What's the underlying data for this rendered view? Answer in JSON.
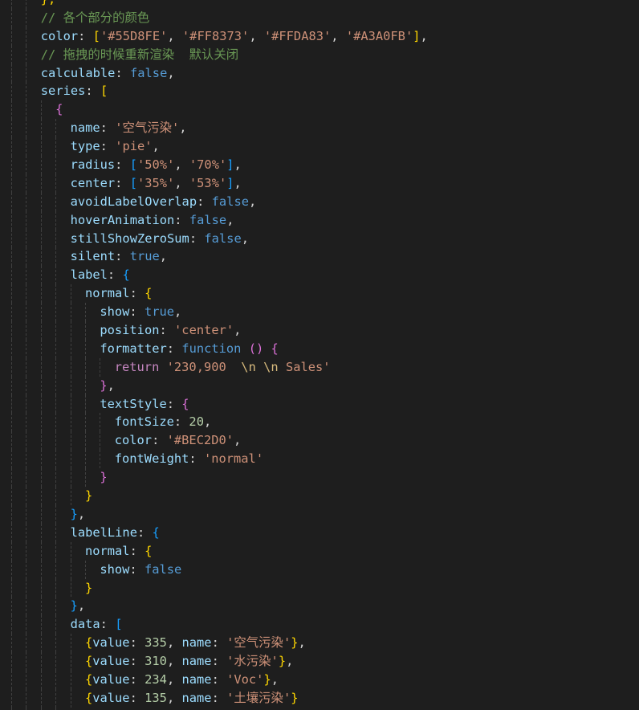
{
  "lines": [
    {
      "indent": 2,
      "tokens": [
        {
          "t": "},",
          "c": "b1"
        }
      ]
    },
    {
      "indent": 2,
      "tokens": [
        {
          "t": "// 各个部分的颜色",
          "c": "cmt"
        }
      ]
    },
    {
      "indent": 2,
      "tokens": [
        {
          "t": "color",
          "c": "key"
        },
        {
          "t": ": ",
          "c": "punc"
        },
        {
          "t": "[",
          "c": "b1"
        },
        {
          "t": "'#55D8FE'",
          "c": "str"
        },
        {
          "t": ", ",
          "c": "punc"
        },
        {
          "t": "'#FF8373'",
          "c": "str"
        },
        {
          "t": ", ",
          "c": "punc"
        },
        {
          "t": "'#FFDA83'",
          "c": "str"
        },
        {
          "t": ", ",
          "c": "punc"
        },
        {
          "t": "'#A3A0FB'",
          "c": "str"
        },
        {
          "t": "]",
          "c": "b1"
        },
        {
          "t": ",",
          "c": "punc"
        }
      ]
    },
    {
      "indent": 2,
      "tokens": [
        {
          "t": "// 拖拽的时候重新渲染  默认关闭",
          "c": "cmt"
        }
      ]
    },
    {
      "indent": 2,
      "tokens": [
        {
          "t": "calculable",
          "c": "key"
        },
        {
          "t": ": ",
          "c": "punc"
        },
        {
          "t": "false",
          "c": "bool"
        },
        {
          "t": ",",
          "c": "punc"
        }
      ]
    },
    {
      "indent": 2,
      "tokens": [
        {
          "t": "series",
          "c": "key"
        },
        {
          "t": ": ",
          "c": "punc"
        },
        {
          "t": "[",
          "c": "b1"
        }
      ]
    },
    {
      "indent": 3,
      "tokens": [
        {
          "t": "{",
          "c": "b2"
        }
      ]
    },
    {
      "indent": 4,
      "tokens": [
        {
          "t": "name",
          "c": "key"
        },
        {
          "t": ": ",
          "c": "punc"
        },
        {
          "t": "'空气污染'",
          "c": "str"
        },
        {
          "t": ",",
          "c": "punc"
        }
      ]
    },
    {
      "indent": 4,
      "tokens": [
        {
          "t": "type",
          "c": "key"
        },
        {
          "t": ": ",
          "c": "punc"
        },
        {
          "t": "'pie'",
          "c": "str"
        },
        {
          "t": ",",
          "c": "punc"
        }
      ]
    },
    {
      "indent": 4,
      "tokens": [
        {
          "t": "radius",
          "c": "key"
        },
        {
          "t": ": ",
          "c": "punc"
        },
        {
          "t": "[",
          "c": "b3"
        },
        {
          "t": "'50%'",
          "c": "str"
        },
        {
          "t": ", ",
          "c": "punc"
        },
        {
          "t": "'70%'",
          "c": "str"
        },
        {
          "t": "]",
          "c": "b3"
        },
        {
          "t": ",",
          "c": "punc"
        }
      ]
    },
    {
      "indent": 4,
      "tokens": [
        {
          "t": "center",
          "c": "key"
        },
        {
          "t": ": ",
          "c": "punc"
        },
        {
          "t": "[",
          "c": "b3"
        },
        {
          "t": "'35%'",
          "c": "str"
        },
        {
          "t": ", ",
          "c": "punc"
        },
        {
          "t": "'53%'",
          "c": "str"
        },
        {
          "t": "]",
          "c": "b3"
        },
        {
          "t": ",",
          "c": "punc"
        }
      ]
    },
    {
      "indent": 4,
      "tokens": [
        {
          "t": "avoidLabelOverlap",
          "c": "key"
        },
        {
          "t": ": ",
          "c": "punc"
        },
        {
          "t": "false",
          "c": "bool"
        },
        {
          "t": ",",
          "c": "punc"
        }
      ]
    },
    {
      "indent": 4,
      "tokens": [
        {
          "t": "hoverAnimation",
          "c": "key"
        },
        {
          "t": ": ",
          "c": "punc"
        },
        {
          "t": "false",
          "c": "bool"
        },
        {
          "t": ",",
          "c": "punc"
        }
      ]
    },
    {
      "indent": 4,
      "tokens": [
        {
          "t": "stillShowZeroSum",
          "c": "key"
        },
        {
          "t": ": ",
          "c": "punc"
        },
        {
          "t": "false",
          "c": "bool"
        },
        {
          "t": ",",
          "c": "punc"
        }
      ]
    },
    {
      "indent": 4,
      "tokens": [
        {
          "t": "silent",
          "c": "key"
        },
        {
          "t": ": ",
          "c": "punc"
        },
        {
          "t": "true",
          "c": "bool"
        },
        {
          "t": ",",
          "c": "punc"
        }
      ]
    },
    {
      "indent": 4,
      "tokens": [
        {
          "t": "label",
          "c": "key"
        },
        {
          "t": ": ",
          "c": "punc"
        },
        {
          "t": "{",
          "c": "b3"
        }
      ]
    },
    {
      "indent": 5,
      "tokens": [
        {
          "t": "normal",
          "c": "key"
        },
        {
          "t": ": ",
          "c": "punc"
        },
        {
          "t": "{",
          "c": "b1"
        }
      ]
    },
    {
      "indent": 6,
      "tokens": [
        {
          "t": "show",
          "c": "key"
        },
        {
          "t": ": ",
          "c": "punc"
        },
        {
          "t": "true",
          "c": "bool"
        },
        {
          "t": ",",
          "c": "punc"
        }
      ]
    },
    {
      "indent": 6,
      "tokens": [
        {
          "t": "position",
          "c": "key"
        },
        {
          "t": ": ",
          "c": "punc"
        },
        {
          "t": "'center'",
          "c": "str"
        },
        {
          "t": ",",
          "c": "punc"
        }
      ]
    },
    {
      "indent": 6,
      "tokens": [
        {
          "t": "formatter",
          "c": "key"
        },
        {
          "t": ": ",
          "c": "punc"
        },
        {
          "t": "function",
          "c": "kw"
        },
        {
          "t": " ",
          "c": "punc"
        },
        {
          "t": "()",
          "c": "b2"
        },
        {
          "t": " ",
          "c": "punc"
        },
        {
          "t": "{",
          "c": "b2"
        }
      ]
    },
    {
      "indent": 7,
      "tokens": [
        {
          "t": "return",
          "c": "ctl"
        },
        {
          "t": " ",
          "c": "punc"
        },
        {
          "t": "'230,900  ",
          "c": "str"
        },
        {
          "t": "\\n",
          "c": "esc"
        },
        {
          "t": " ",
          "c": "str"
        },
        {
          "t": "\\n",
          "c": "esc"
        },
        {
          "t": " Sales'",
          "c": "str"
        }
      ]
    },
    {
      "indent": 6,
      "tokens": [
        {
          "t": "}",
          "c": "b2"
        },
        {
          "t": ",",
          "c": "punc"
        }
      ]
    },
    {
      "indent": 6,
      "tokens": [
        {
          "t": "textStyle",
          "c": "key"
        },
        {
          "t": ": ",
          "c": "punc"
        },
        {
          "t": "{",
          "c": "b2"
        }
      ]
    },
    {
      "indent": 7,
      "tokens": [
        {
          "t": "fontSize",
          "c": "key"
        },
        {
          "t": ": ",
          "c": "punc"
        },
        {
          "t": "20",
          "c": "num"
        },
        {
          "t": ",",
          "c": "punc"
        }
      ]
    },
    {
      "indent": 7,
      "tokens": [
        {
          "t": "color",
          "c": "key"
        },
        {
          "t": ": ",
          "c": "punc"
        },
        {
          "t": "'#BEC2D0'",
          "c": "str"
        },
        {
          "t": ",",
          "c": "punc"
        }
      ]
    },
    {
      "indent": 7,
      "tokens": [
        {
          "t": "fontWeight",
          "c": "key"
        },
        {
          "t": ": ",
          "c": "punc"
        },
        {
          "t": "'normal'",
          "c": "str"
        }
      ]
    },
    {
      "indent": 6,
      "tokens": [
        {
          "t": "}",
          "c": "b2"
        }
      ]
    },
    {
      "indent": 5,
      "tokens": [
        {
          "t": "}",
          "c": "b1"
        }
      ]
    },
    {
      "indent": 4,
      "tokens": [
        {
          "t": "}",
          "c": "b3"
        },
        {
          "t": ",",
          "c": "punc"
        }
      ]
    },
    {
      "indent": 4,
      "tokens": [
        {
          "t": "labelLine",
          "c": "key"
        },
        {
          "t": ": ",
          "c": "punc"
        },
        {
          "t": "{",
          "c": "b3"
        }
      ]
    },
    {
      "indent": 5,
      "tokens": [
        {
          "t": "normal",
          "c": "key"
        },
        {
          "t": ": ",
          "c": "punc"
        },
        {
          "t": "{",
          "c": "b1"
        }
      ]
    },
    {
      "indent": 6,
      "tokens": [
        {
          "t": "show",
          "c": "key"
        },
        {
          "t": ": ",
          "c": "punc"
        },
        {
          "t": "false",
          "c": "bool"
        }
      ]
    },
    {
      "indent": 5,
      "tokens": [
        {
          "t": "}",
          "c": "b1"
        }
      ]
    },
    {
      "indent": 4,
      "tokens": [
        {
          "t": "}",
          "c": "b3"
        },
        {
          "t": ",",
          "c": "punc"
        }
      ]
    },
    {
      "indent": 4,
      "tokens": [
        {
          "t": "data",
          "c": "key"
        },
        {
          "t": ": ",
          "c": "punc"
        },
        {
          "t": "[",
          "c": "b3"
        }
      ]
    },
    {
      "indent": 5,
      "tokens": [
        {
          "t": "{",
          "c": "b1"
        },
        {
          "t": "value",
          "c": "key"
        },
        {
          "t": ": ",
          "c": "punc"
        },
        {
          "t": "335",
          "c": "num"
        },
        {
          "t": ", ",
          "c": "punc"
        },
        {
          "t": "name",
          "c": "key"
        },
        {
          "t": ": ",
          "c": "punc"
        },
        {
          "t": "'空气污染'",
          "c": "str"
        },
        {
          "t": "}",
          "c": "b1"
        },
        {
          "t": ",",
          "c": "punc"
        }
      ]
    },
    {
      "indent": 5,
      "tokens": [
        {
          "t": "{",
          "c": "b1"
        },
        {
          "t": "value",
          "c": "key"
        },
        {
          "t": ": ",
          "c": "punc"
        },
        {
          "t": "310",
          "c": "num"
        },
        {
          "t": ", ",
          "c": "punc"
        },
        {
          "t": "name",
          "c": "key"
        },
        {
          "t": ": ",
          "c": "punc"
        },
        {
          "t": "'水污染'",
          "c": "str"
        },
        {
          "t": "}",
          "c": "b1"
        },
        {
          "t": ",",
          "c": "punc"
        }
      ]
    },
    {
      "indent": 5,
      "tokens": [
        {
          "t": "{",
          "c": "b1"
        },
        {
          "t": "value",
          "c": "key"
        },
        {
          "t": ": ",
          "c": "punc"
        },
        {
          "t": "234",
          "c": "num"
        },
        {
          "t": ", ",
          "c": "punc"
        },
        {
          "t": "name",
          "c": "key"
        },
        {
          "t": ": ",
          "c": "punc"
        },
        {
          "t": "'Voc'",
          "c": "str"
        },
        {
          "t": "}",
          "c": "b1"
        },
        {
          "t": ",",
          "c": "punc"
        }
      ]
    },
    {
      "indent": 5,
      "tokens": [
        {
          "t": "{",
          "c": "b1"
        },
        {
          "t": "value",
          "c": "key"
        },
        {
          "t": ": ",
          "c": "punc"
        },
        {
          "t": "135",
          "c": "num"
        },
        {
          "t": ", ",
          "c": "punc"
        },
        {
          "t": "name",
          "c": "key"
        },
        {
          "t": ": ",
          "c": "punc"
        },
        {
          "t": "'土壤污染'",
          "c": "str"
        },
        {
          "t": "}",
          "c": "b1"
        }
      ]
    },
    {
      "indent": 4,
      "tokens": [
        {
          "t": "]",
          "c": "b3"
        }
      ]
    }
  ]
}
